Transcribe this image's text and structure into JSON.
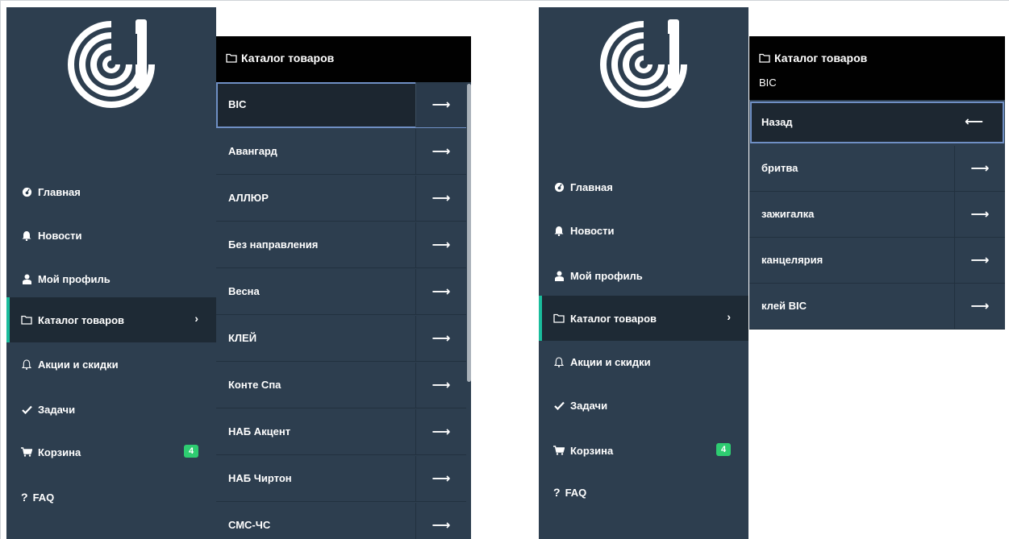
{
  "left_view": {
    "nav": [
      {
        "label": "Главная",
        "icon": "dashboard-icon"
      },
      {
        "label": "Новости",
        "icon": "bell-filled-icon"
      },
      {
        "label": "Мой профиль",
        "icon": "user-icon"
      },
      {
        "label": "Каталог товаров",
        "icon": "folder-icon",
        "active": true
      },
      {
        "label": "Акции и скидки",
        "icon": "bell-outline-icon"
      },
      {
        "label": "Задачи",
        "icon": "check-icon"
      },
      {
        "label": "Корзина",
        "icon": "cart-icon",
        "badge": "4"
      },
      {
        "label": "FAQ",
        "icon": "question-icon",
        "prefix": "?"
      }
    ],
    "catalog": {
      "title": "Каталог товаров",
      "items": [
        "BIC",
        "Авангард",
        "АЛЛЮР",
        "Без направления",
        "Весна",
        "КЛЕЙ",
        "Конте Спа",
        "НАБ Акцент",
        "НАБ Чиртон",
        "СМС-ЧС"
      ],
      "selected_index": 0,
      "arrow": "⟶"
    }
  },
  "right_view": {
    "nav": [
      {
        "label": "Главная",
        "icon": "dashboard-icon"
      },
      {
        "label": "Новости",
        "icon": "bell-filled-icon"
      },
      {
        "label": "Мой профиль",
        "icon": "user-icon"
      },
      {
        "label": "Каталог товаров",
        "icon": "folder-icon",
        "active": true
      },
      {
        "label": "Акции и скидки",
        "icon": "bell-outline-icon"
      },
      {
        "label": "Задачи",
        "icon": "check-icon"
      },
      {
        "label": "Корзина",
        "icon": "cart-icon",
        "badge": "4"
      },
      {
        "label": "FAQ",
        "icon": "question-icon",
        "prefix": "?"
      }
    ],
    "catalog": {
      "title": "Каталог товаров",
      "subtitle": "BIC",
      "back_label": "Назад",
      "back_arrow": "⟵",
      "items": [
        "бритва",
        "зажигалка",
        "канцелярия",
        "клей BIC"
      ],
      "arrow": "⟶"
    }
  },
  "colors": {
    "sidebar_bg": "#2d3e4f",
    "active_bg": "#1e2a35",
    "accent": "#1abc9c",
    "badge": "#2ecc71",
    "header_bg": "#010101",
    "selection_outline": "#6f8fc4"
  }
}
